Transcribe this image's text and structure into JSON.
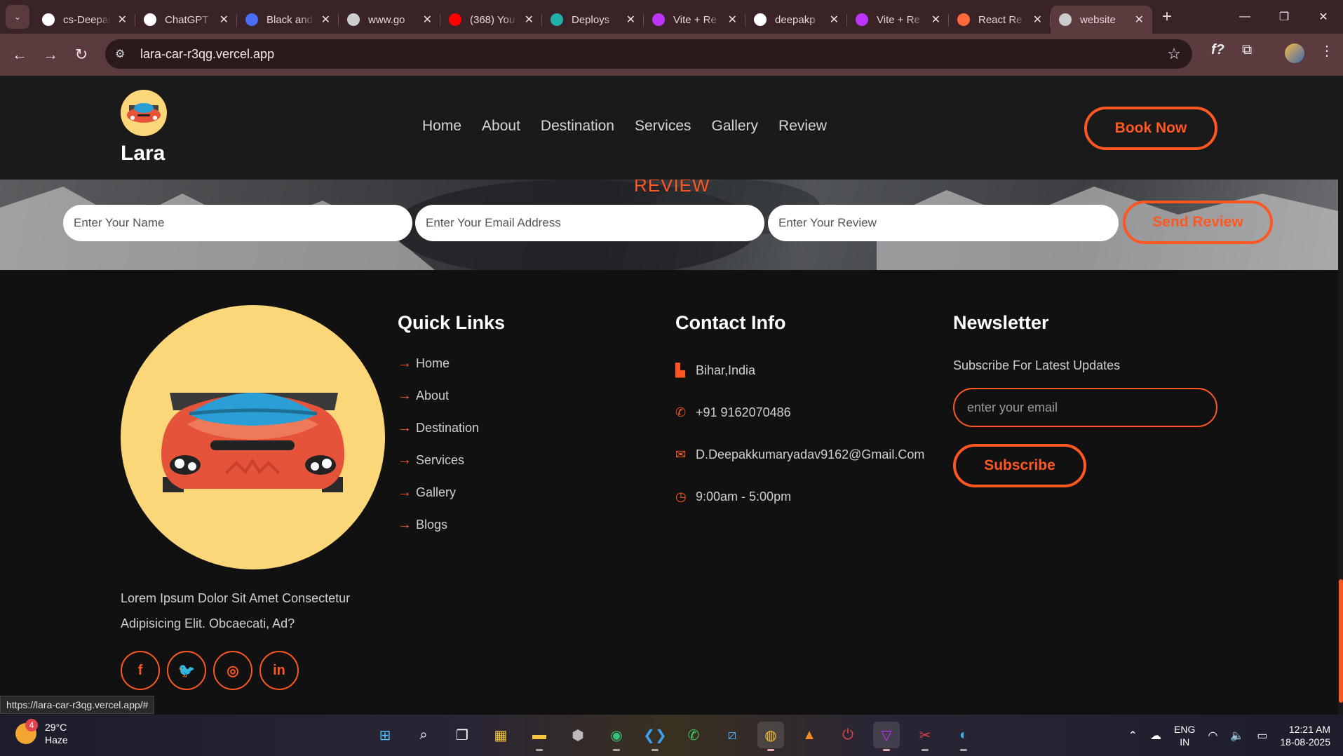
{
  "browser": {
    "tabs": [
      {
        "title": "cs-Deepak",
        "icon": "github-icon",
        "color": "#ffffff"
      },
      {
        "title": "ChatGPT",
        "icon": "chatgpt-icon",
        "color": "#ffffff"
      },
      {
        "title": "Black and",
        "icon": "app-icon",
        "color": "#4a6cf7"
      },
      {
        "title": "www.go",
        "icon": "globe-icon",
        "color": "#cccccc"
      },
      {
        "title": "(368) You",
        "icon": "youtube-icon",
        "color": "#ff0000"
      },
      {
        "title": "Deploys",
        "icon": "render-icon",
        "color": "#20b2aa"
      },
      {
        "title": "Vite + Re",
        "icon": "vite-icon",
        "color": "#bd34fe"
      },
      {
        "title": "deepakp",
        "icon": "netlify-icon",
        "color": "#ffffff"
      },
      {
        "title": "Vite + Re",
        "icon": "vite-icon",
        "color": "#bd34fe"
      },
      {
        "title": "React Re",
        "icon": "react-icon",
        "color": "#ff6a3d"
      },
      {
        "title": "website",
        "icon": "globe-icon",
        "color": "#cccccc"
      }
    ],
    "url": "lara-car-r3qg.vercel.app",
    "status_url": "https://lara-car-r3qg.vercel.app/#"
  },
  "header": {
    "brand": "Lara",
    "nav": [
      "Home",
      "About",
      "Destination",
      "Services",
      "Gallery",
      "Review"
    ],
    "cta": "Book Now"
  },
  "review": {
    "heading": "REVIEW",
    "name_placeholder": "Enter Your Name",
    "email_placeholder": "Enter Your Email Address",
    "review_placeholder": "Enter Your Review",
    "submit": "Send Review"
  },
  "footer": {
    "about": "Lorem Ipsum Dolor Sit Amet Consectetur Adipisicing Elit. Obcaecati, Ad?",
    "socials": [
      {
        "icon": "facebook-icon",
        "glyph": "f"
      },
      {
        "icon": "twitter-icon",
        "glyph": "🐦"
      },
      {
        "icon": "instagram-icon",
        "glyph": "◎"
      },
      {
        "icon": "linkedin-icon",
        "glyph": "in"
      }
    ],
    "quick_links": {
      "title": "Quick Links",
      "items": [
        "Home",
        "About",
        "Destination",
        "Services",
        "Gallery",
        "Blogs"
      ]
    },
    "contact": {
      "title": "Contact Info",
      "items": [
        {
          "icon": "map-icon",
          "text": "Bihar,India"
        },
        {
          "icon": "phone-icon",
          "text": "+91 9162070486"
        },
        {
          "icon": "envelope-icon",
          "text": "D.Deepakkumaryadav9162@Gmail.Com"
        },
        {
          "icon": "clock-icon",
          "text": "9:00am - 5:00pm"
        }
      ]
    },
    "newsletter": {
      "title": "Newsletter",
      "subtitle": "Subscribe For Latest Updates",
      "placeholder": "enter your email",
      "button": "Subscribe"
    }
  },
  "taskbar": {
    "weather_temp": "29°C",
    "weather_desc": "Haze",
    "weather_badge": "4",
    "lang_top": "ENG",
    "lang_bottom": "IN",
    "time": "12:21 AM",
    "date": "18-08-2025"
  },
  "colors": {
    "accent": "#ff5722",
    "logo_bg": "#fcd77a",
    "footer_bg": "#111111"
  }
}
